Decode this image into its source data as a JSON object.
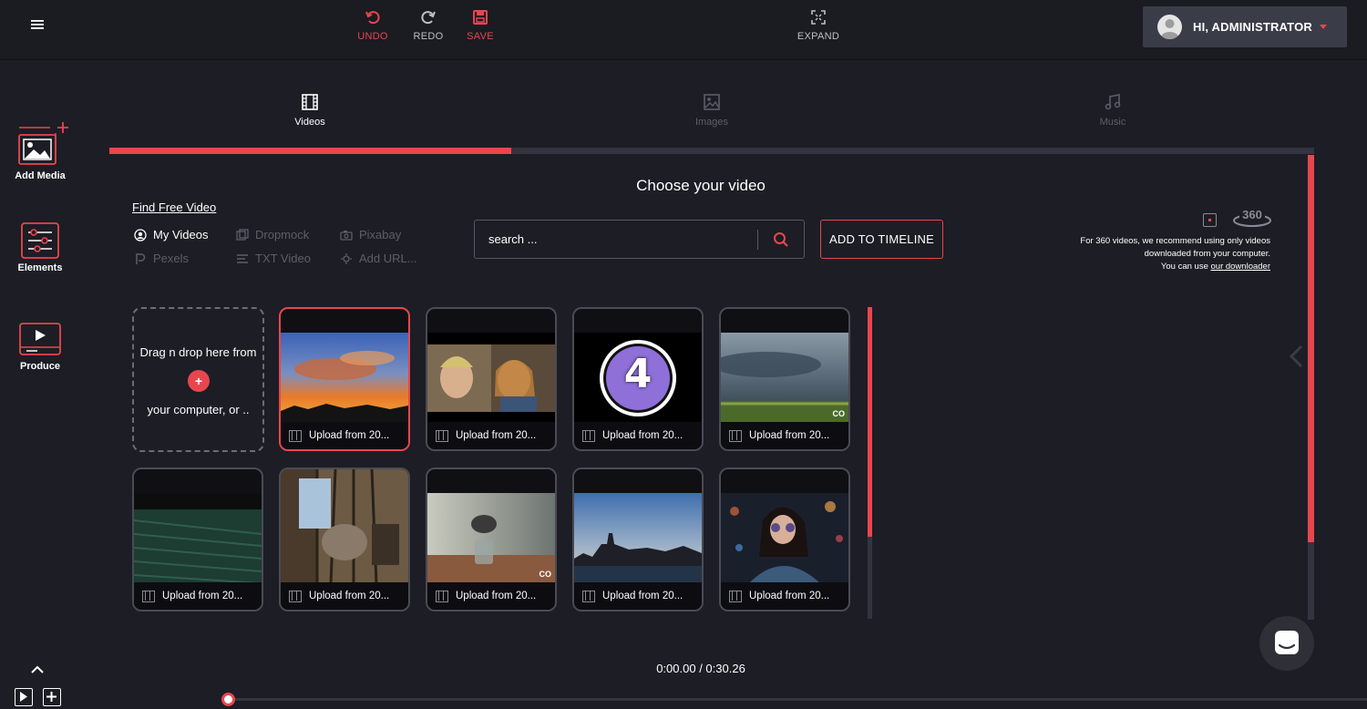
{
  "toolbar": {
    "undo_label": "UNDO",
    "redo_label": "REDO",
    "save_label": "SAVE",
    "expand_label": "EXPAND"
  },
  "user": {
    "greeting": "HI, ADMINISTRATOR"
  },
  "sidebar": {
    "items": [
      {
        "label": "Add Media",
        "icon": "add-media-icon"
      },
      {
        "label": "Elements",
        "icon": "sliders-icon"
      },
      {
        "label": "Produce",
        "icon": "produce-icon"
      }
    ]
  },
  "tabs": [
    {
      "label": "Videos",
      "icon": "film-icon",
      "active": true
    },
    {
      "label": "Images",
      "icon": "image-icon",
      "active": false
    },
    {
      "label": "Music",
      "icon": "music-icon",
      "active": false
    }
  ],
  "panel": {
    "title": "Choose your video",
    "find_free": "Find Free Video",
    "sources": [
      {
        "label": "My Videos",
        "active": true
      },
      {
        "label": "Dropmock",
        "active": false
      },
      {
        "label": "Pixabay",
        "active": false
      },
      {
        "label": "Pexels",
        "active": false
      },
      {
        "label": "TXT Video",
        "active": false
      },
      {
        "label": "Add URL...",
        "active": false
      }
    ],
    "search_placeholder": "search ...",
    "add_to_timeline": "ADD TO TIMELINE",
    "note360": {
      "badge": "360",
      "line1": "For 360 videos, we recommend using only videos",
      "line2": "downloaded from your computer.",
      "line3_prefix": "You can use ",
      "line3_link": "our downloader"
    },
    "drop": {
      "line1": "Drag n drop here from",
      "plus": "+",
      "line2": "your computer, or .."
    },
    "videos": [
      {
        "caption": "Upload from 20...",
        "scene": "sunset",
        "selected": true
      },
      {
        "caption": "Upload from 20...",
        "scene": "people",
        "selected": false
      },
      {
        "caption": "Upload from 20...",
        "scene": "countdown",
        "selected": false,
        "overlay": "4"
      },
      {
        "caption": "Upload from 20...",
        "scene": "storm",
        "selected": false,
        "badge": "CO"
      },
      {
        "caption": "Upload from 20...",
        "scene": "wall",
        "selected": false
      },
      {
        "caption": "Upload from 20...",
        "scene": "street",
        "selected": false
      },
      {
        "caption": "Upload from 20...",
        "scene": "glass",
        "selected": false,
        "badge": "CO"
      },
      {
        "caption": "Upload from 20...",
        "scene": "city",
        "selected": false
      },
      {
        "caption": "Upload from 20...",
        "scene": "portrait",
        "selected": false
      }
    ]
  },
  "player": {
    "current": "0:00.00",
    "separator": " / ",
    "total": "0:30.26"
  },
  "colors": {
    "accent": "#e8464e",
    "background": "#1d1d25",
    "topbar": "#1b1b22"
  }
}
